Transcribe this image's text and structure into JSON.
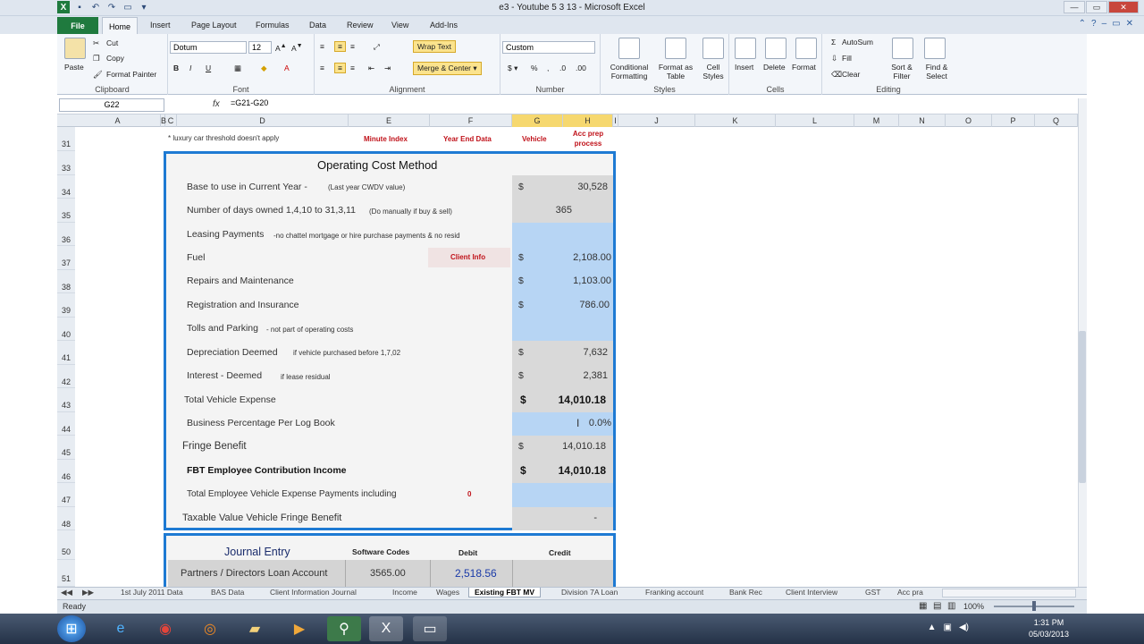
{
  "window": {
    "title": "e3 - Youtube 5 3 13 - Microsoft Excel"
  },
  "ribbon": {
    "tabs": [
      "File",
      "Home",
      "Insert",
      "Page Layout",
      "Formulas",
      "Data",
      "Review",
      "View",
      "Add-Ins"
    ],
    "clipboard": {
      "paste": "Paste",
      "cut": "Cut",
      "copy": "Copy",
      "format_painter": "Format Painter",
      "label": "Clipboard"
    },
    "font": {
      "name": "Dotum",
      "size": "12",
      "label": "Font"
    },
    "alignment": {
      "wrap": "Wrap Text",
      "merge": "Merge & Center",
      "label": "Alignment"
    },
    "number": {
      "format": "Custom",
      "label": "Number"
    },
    "styles": {
      "conditional": "Conditional Formatting",
      "table": "Format as Table",
      "cell": "Cell Styles",
      "label": "Styles"
    },
    "cells": {
      "insert": "Insert",
      "delete": "Delete",
      "format": "Format",
      "label": "Cells"
    },
    "editing": {
      "autosum": "AutoSum",
      "fill": "Fill",
      "clear": "Clear",
      "sort": "Sort & Filter",
      "find": "Find & Select",
      "label": "Editing"
    }
  },
  "formula_bar": {
    "name_box": "G22",
    "formula": "=G21-G20"
  },
  "columns": [
    "A",
    "B",
    "C",
    "D",
    "E",
    "F",
    "G",
    "H",
    "I",
    "J",
    "K",
    "L",
    "M",
    "N",
    "O",
    "P",
    "Q"
  ],
  "rows": [
    "31",
    "33",
    "34",
    "35",
    "36",
    "37",
    "38",
    "39",
    "40",
    "41",
    "42",
    "43",
    "44",
    "45",
    "46",
    "47",
    "48",
    "50",
    "51"
  ],
  "header_row": {
    "note": "* luxury car threshold doesn't apply",
    "e": "Minute Index",
    "f": "Year End Data",
    "g": "Vehicle",
    "h": "Acc prep process"
  },
  "section_title": "Operating Cost Method",
  "items": [
    {
      "label": "Base to use in Current Year - ",
      "note": "(Last year CWDV value)",
      "cur": "$",
      "value": "30,528"
    },
    {
      "label": "Number of days owned 1,4,10 to 31,3,11",
      "note": "(Do manually if buy & sell)",
      "cur": "",
      "value": "365"
    },
    {
      "label": "Leasing Payments",
      "note": "-no chattel mortgage or hire purchase payments & no resid",
      "cur": "",
      "value": ""
    },
    {
      "label": "Fuel",
      "note": "",
      "cur": "$",
      "value": "2,108.00"
    },
    {
      "label": "Repairs and Maintenance",
      "note": "",
      "cur": "$",
      "value": "1,103.00"
    },
    {
      "label": "Registration and Insurance",
      "note": "",
      "cur": "$",
      "value": "786.00"
    },
    {
      "label": "Tolls and Parking",
      "note": " - not part of operating costs",
      "cur": "",
      "value": ""
    },
    {
      "label": "Depreciation Deemed",
      "note": "if vehicle purchased before 1,7,02",
      "cur": "$",
      "value": "7,632"
    },
    {
      "label": "Interest - Deemed",
      "note": "if lease residual",
      "cur": "$",
      "value": "2,381"
    },
    {
      "label": "Total Vehicle Expense",
      "note": "",
      "cur": "$",
      "value": "14,010.18"
    },
    {
      "label": "Business Percentage Per Log Book",
      "note": "",
      "cur": "",
      "value": "0.0%"
    },
    {
      "label": "Fringe Benefit",
      "note": "",
      "cur": "$",
      "value": "14,010.18"
    },
    {
      "label": "FBT Employee Contribution Income",
      "note": "",
      "cur": "$",
      "value": "14,010.18"
    },
    {
      "label": "Total Employee Vehicle Expense Payments including",
      "note": "",
      "cur": "",
      "value": ""
    },
    {
      "label": "Taxable Value Vehicle Fringe Benefit",
      "note": "",
      "cur": "",
      "value": "-"
    }
  ],
  "client_info": "Client Info",
  "zero_mark": "0",
  "journal": {
    "title": "Journal Entry",
    "codes": "Software Codes",
    "debit": "Debit",
    "credit": "Credit",
    "row_label": "Partners / Directors Loan Account",
    "row_code": "3565.00",
    "row_debit": "2,518.56"
  },
  "sheet_tabs": [
    "1st July 2011 Data",
    "BAS Data",
    "Client Information Journal",
    "Income",
    "Wages",
    "Existing FBT MV",
    "Division 7A Loan",
    "Franking account",
    "Bank Rec",
    "Client Interview",
    "GST",
    "Acc pra"
  ],
  "status": {
    "ready": "Ready",
    "zoom": "100%"
  },
  "clock": {
    "time": "1:31 PM",
    "date": "05/03/2013"
  }
}
